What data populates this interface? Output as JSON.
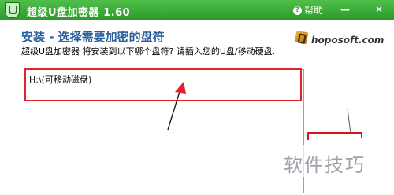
{
  "window": {
    "title": "超级U盘加密器  1.60",
    "help_label": "帮助",
    "minimize": "—",
    "close": "✕"
  },
  "header": {
    "title": "安装 - 选择需要加密的盘符",
    "subtitle": "超级U盘加密器 将安装到以下哪个盘符? 请插入您的U盘/移动硬盘.",
    "logo_text": "hoposoft.com"
  },
  "drive_list": {
    "items": [
      {
        "label": "H:\\(可移动磁盘)"
      }
    ]
  },
  "overlay": {
    "watermark": "软件技巧"
  },
  "colors": {
    "titlebar": "#3aa63a",
    "title_text": "#2a5f9e",
    "annotation": "#e0232b"
  }
}
